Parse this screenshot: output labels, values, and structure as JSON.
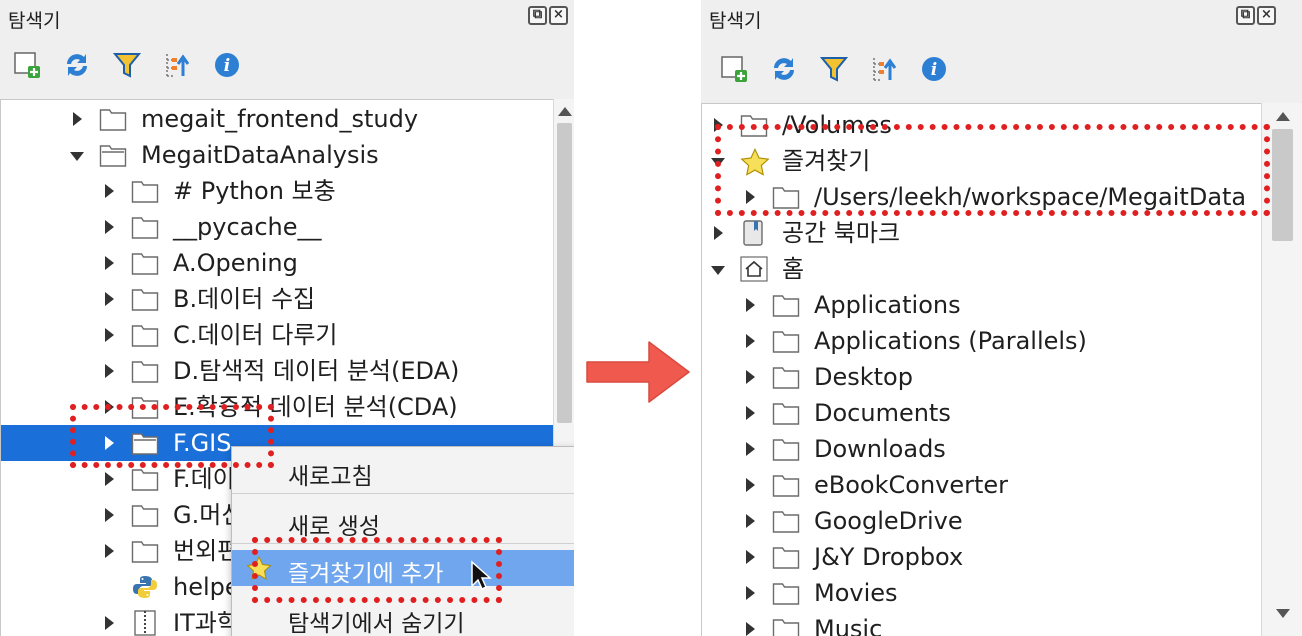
{
  "colors": {
    "selection": "#1b6fd9",
    "menu_highlight": "#6fa6ee",
    "annotation": "#e02020",
    "arrow": "#f05a4e"
  },
  "left_panel": {
    "title": "탐색기",
    "toolbar_icons": [
      "add-layer-icon",
      "refresh-icon",
      "filter-icon",
      "collapse-icon",
      "info-icon"
    ],
    "tree": [
      {
        "label": "megait_frontend_study",
        "arrow": "collapsed",
        "icon": "folder-icon"
      },
      {
        "label": "MegaitDataAnalysis",
        "arrow": "expanded",
        "icon": "folder-open-icon"
      },
      {
        "label": "# Python 보충",
        "arrow": "collapsed",
        "icon": "folder-icon"
      },
      {
        "label": "__pycache__",
        "arrow": "collapsed",
        "icon": "folder-icon"
      },
      {
        "label": "A.Opening",
        "arrow": "collapsed",
        "icon": "folder-icon"
      },
      {
        "label": "B.데이터 수집",
        "arrow": "collapsed",
        "icon": "folder-icon"
      },
      {
        "label": "C.데이터 다루기",
        "arrow": "collapsed",
        "icon": "folder-icon"
      },
      {
        "label": "D.탐색적 데이터 분석(EDA)",
        "arrow": "collapsed",
        "icon": "folder-icon"
      },
      {
        "label": "E.확증적 데이터 분석(CDA)",
        "arrow": "collapsed",
        "icon": "folder-icon"
      },
      {
        "label": "F.GIS",
        "arrow": "collapsed",
        "icon": "folder-open-icon",
        "selected": true
      },
      {
        "label": "F.데이",
        "arrow": "collapsed",
        "icon": "folder-icon"
      },
      {
        "label": "G.머신",
        "arrow": "collapsed",
        "icon": "folder-icon"
      },
      {
        "label": "번외편",
        "arrow": "collapsed",
        "icon": "folder-icon"
      },
      {
        "label": "helpe",
        "arrow": "none",
        "icon": "python-icon"
      },
      {
        "label": "IT과학",
        "arrow": "collapsed",
        "icon": "zip-icon"
      }
    ],
    "context_menu": [
      {
        "label": "새로고침"
      },
      {
        "label": "새로 생성"
      },
      {
        "label": "즐겨찾기에 추가",
        "icon": "star-icon",
        "highlighted": true
      },
      {
        "label": "탐색기에서 숨기기"
      }
    ]
  },
  "right_panel": {
    "title": "탐색기",
    "toolbar_icons": [
      "add-layer-icon",
      "refresh-icon",
      "filter-icon",
      "collapse-icon",
      "info-icon"
    ],
    "tree": [
      {
        "label": "/Volumes",
        "arrow": "collapsed",
        "icon": "folder-icon"
      },
      {
        "label": "즐겨찾기",
        "arrow": "expanded",
        "icon": "star-icon"
      },
      {
        "label": "/Users/leekh/workspace/MegaitData",
        "arrow": "collapsed",
        "icon": "folder-icon"
      },
      {
        "label": "공간 북마크",
        "arrow": "collapsed",
        "icon": "bookmark-icon"
      },
      {
        "label": "홈",
        "arrow": "expanded",
        "icon": "home-icon"
      },
      {
        "label": "Applications",
        "arrow": "collapsed",
        "icon": "folder-icon"
      },
      {
        "label": "Applications (Parallels)",
        "arrow": "collapsed",
        "icon": "folder-icon"
      },
      {
        "label": "Desktop",
        "arrow": "collapsed",
        "icon": "folder-icon"
      },
      {
        "label": "Documents",
        "arrow": "collapsed",
        "icon": "folder-icon"
      },
      {
        "label": "Downloads",
        "arrow": "collapsed",
        "icon": "folder-icon"
      },
      {
        "label": "eBookConverter",
        "arrow": "collapsed",
        "icon": "folder-icon"
      },
      {
        "label": "GoogleDrive",
        "arrow": "collapsed",
        "icon": "folder-icon"
      },
      {
        "label": "J&Y Dropbox",
        "arrow": "collapsed",
        "icon": "folder-icon"
      },
      {
        "label": "Movies",
        "arrow": "collapsed",
        "icon": "folder-icon"
      },
      {
        "label": "Music",
        "arrow": "collapsed",
        "icon": "folder-icon"
      }
    ]
  },
  "transition_arrow": "right-arrow-icon"
}
